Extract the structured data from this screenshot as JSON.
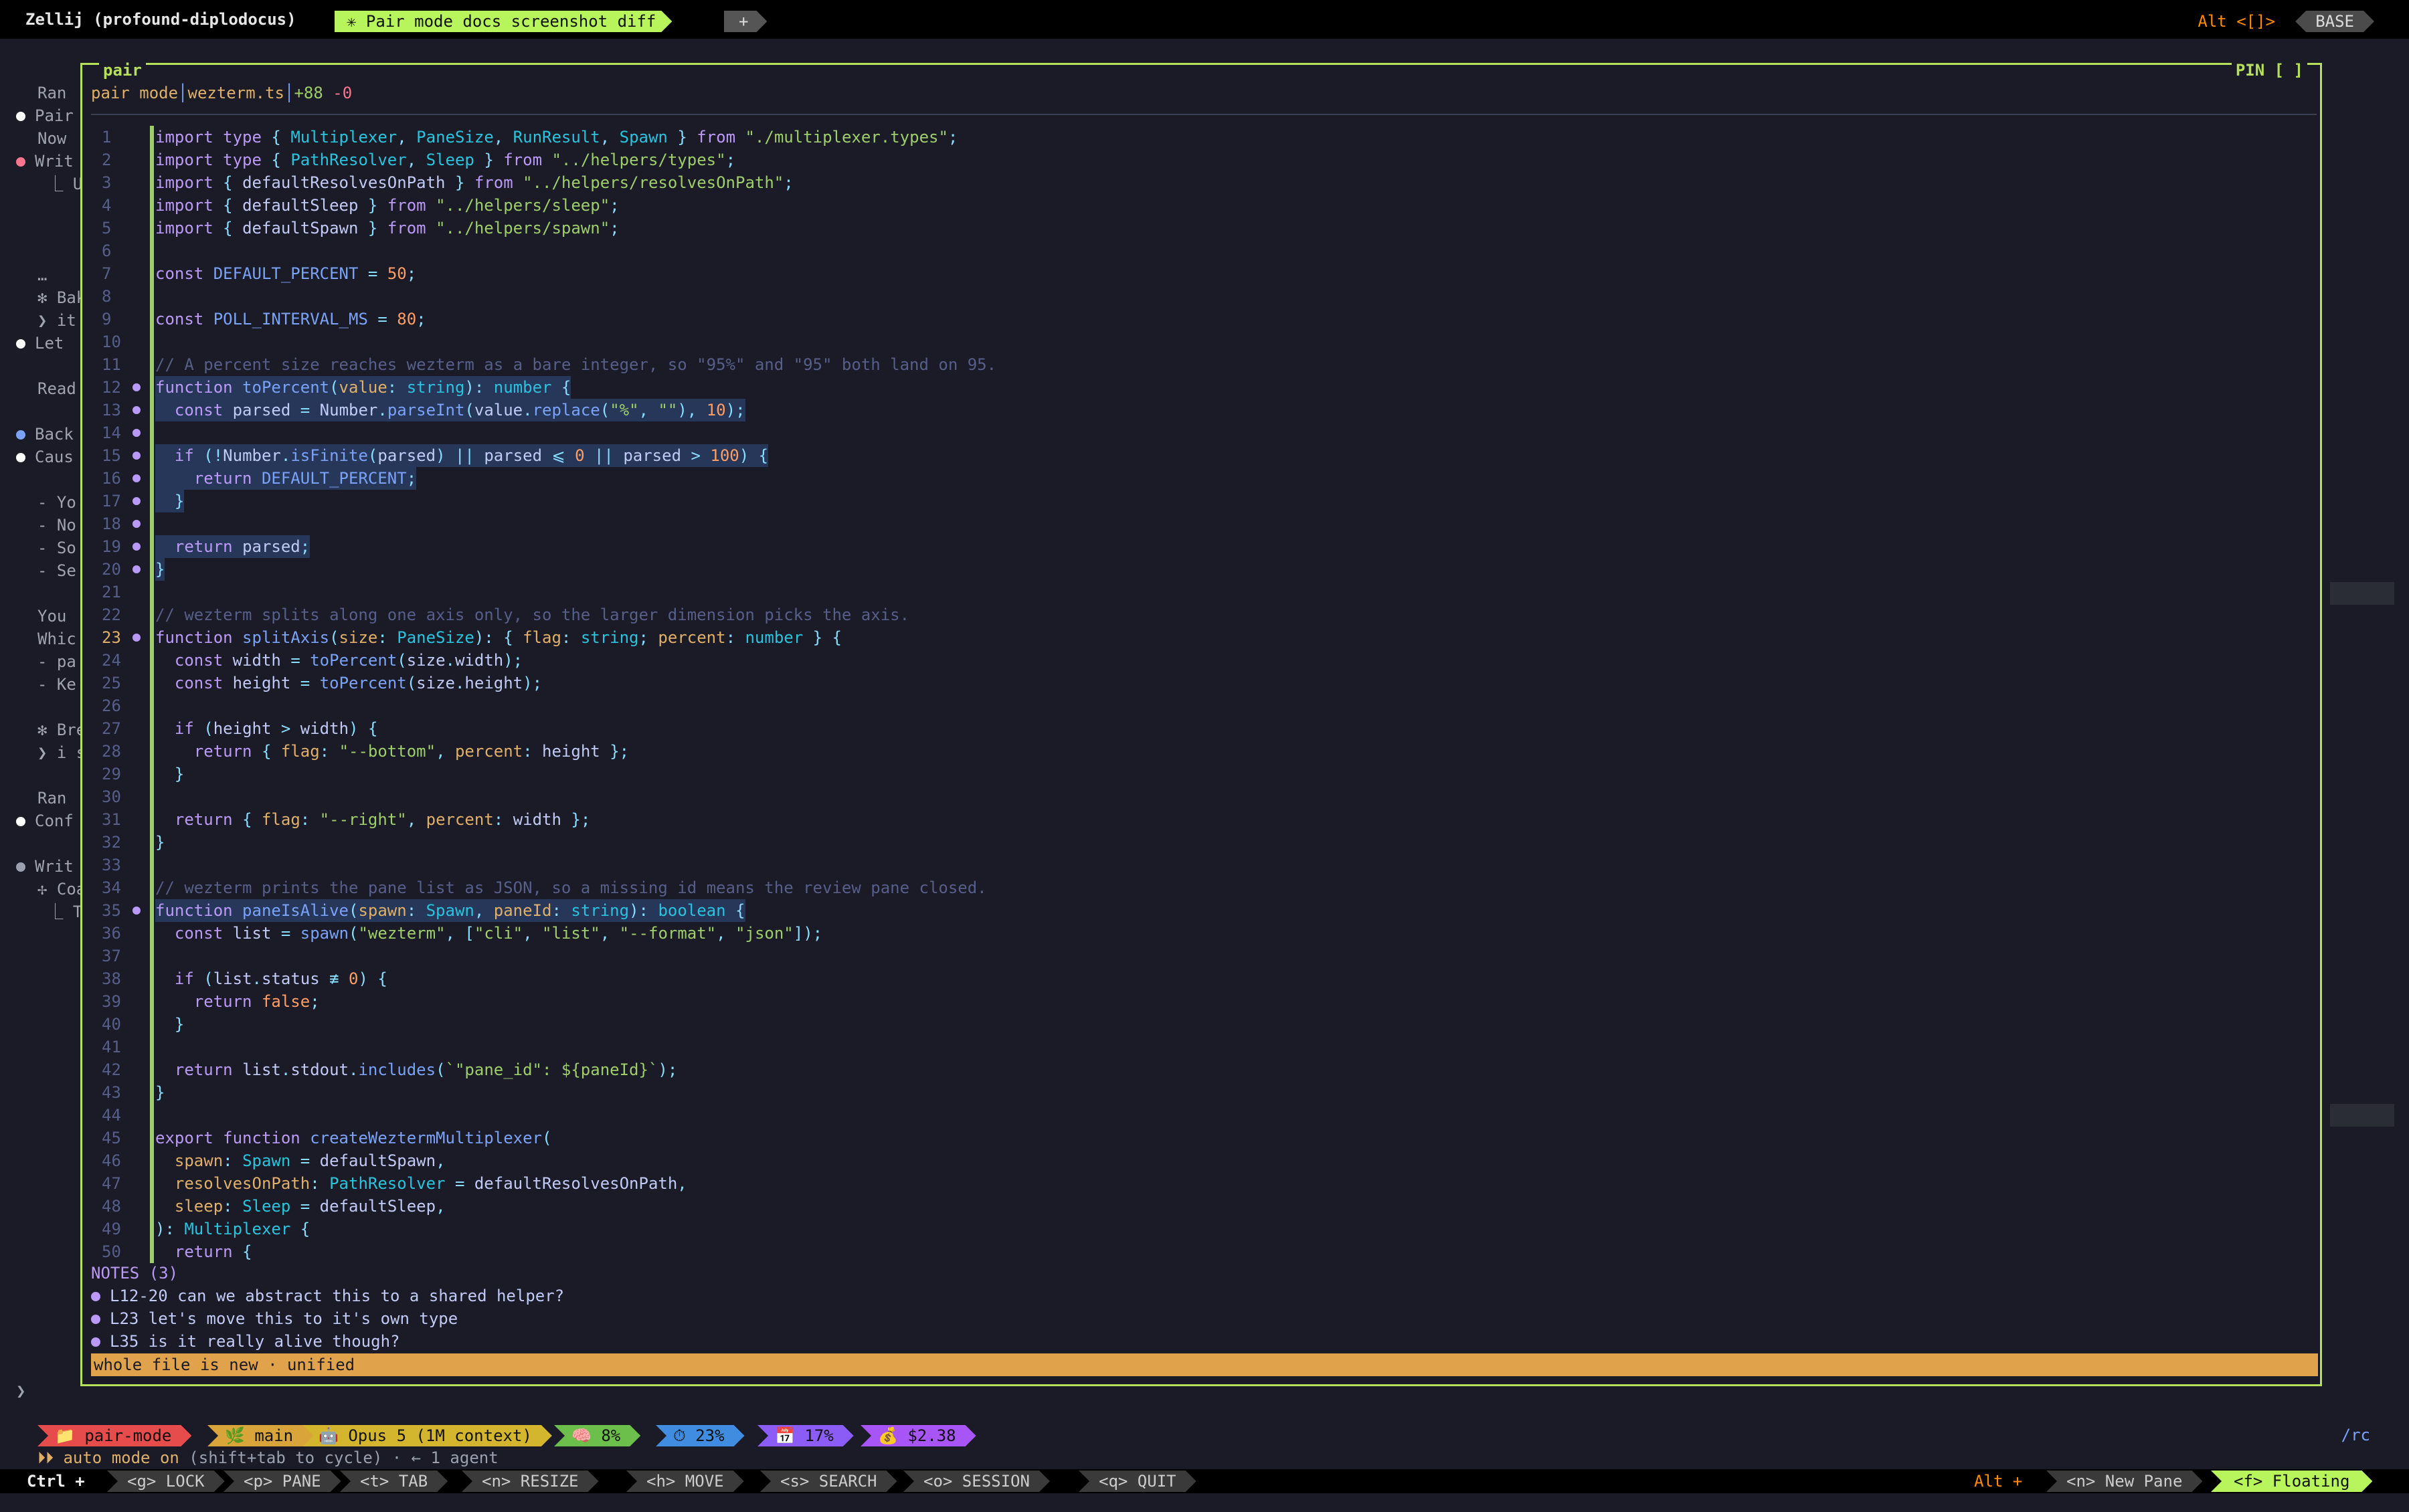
{
  "topbar": {
    "session": "Zellij (profound-diplodocus)",
    "tab": "✳ Pair mode docs screenshot diff",
    "plus": "+",
    "alt_hint": "Alt <[]>",
    "mode": "BASE"
  },
  "background_lines": [
    {
      "text": "Ran",
      "dot": null
    },
    {
      "text": "Pair",
      "dot": "#ffffff"
    },
    {
      "text": "Now",
      "dot": null
    },
    {
      "text": "Writ",
      "dot": "#f7768e"
    },
    {
      "text": " ⎿ U",
      "dot": null
    },
    {
      "text": "…",
      "dot": null
    },
    {
      "text": "✻ Bake",
      "dot": null
    },
    {
      "text": "❯ it d",
      "dot": null
    },
    {
      "text": "Let",
      "dot": "#ffffff"
    },
    {
      "text": "Read",
      "dot": null
    },
    {
      "text": "Back",
      "dot": "#7aa2f7"
    },
    {
      "text": "Caus",
      "dot": "#ffffff"
    },
    {
      "text": "- Yo",
      "dot": null
    },
    {
      "text": "- No",
      "dot": null
    },
    {
      "text": "- So",
      "dot": null
    },
    {
      "text": "- Se",
      "dot": null
    },
    {
      "text": "You",
      "dot": null
    },
    {
      "text": "Whic",
      "dot": null
    },
    {
      "text": "- pa",
      "dot": null
    },
    {
      "text": "- Ke",
      "dot": null
    },
    {
      "text": "✻ Brew",
      "dot": null
    },
    {
      "text": "❯ i sw",
      "dot": null
    },
    {
      "text": "Ran",
      "dot": null
    },
    {
      "text": "Conf",
      "dot": "#ffffff"
    },
    {
      "text": "Writ",
      "dot": "#9aa0b0"
    },
    {
      "text": "✢ Coal",
      "dot": null
    },
    {
      "text": " ⎿ T",
      "dot": null
    }
  ],
  "pane": {
    "title": "pair",
    "pin": "PIN [ ]",
    "mode_label": "pair mode",
    "file": "wezterm.ts",
    "added": "+88",
    "removed": "-0",
    "code_lines": [
      {
        "n": "1",
        "src": "import type { Multiplexer, PaneSize, RunResult, Spawn } from \"./multiplexer.types\";"
      },
      {
        "n": "2",
        "src": "import type { PathResolver, Sleep } from \"../helpers/types\";"
      },
      {
        "n": "3",
        "src": "import { defaultResolvesOnPath } from \"../helpers/resolvesOnPath\";"
      },
      {
        "n": "4",
        "src": "import { defaultSleep } from \"../helpers/sleep\";"
      },
      {
        "n": "5",
        "src": "import { defaultSpawn } from \"../helpers/spawn\";"
      },
      {
        "n": "6",
        "src": ""
      },
      {
        "n": "7",
        "src": "const DEFAULT_PERCENT = 50;"
      },
      {
        "n": "8",
        "src": ""
      },
      {
        "n": "9",
        "src": "const POLL_INTERVAL_MS = 80;"
      },
      {
        "n": "10",
        "src": ""
      },
      {
        "n": "11",
        "src": "// A percent size reaches wezterm as a bare integer, so \"95%\" and \"95\" both land on 95."
      },
      {
        "n": "12",
        "src": "function toPercent(value: string): number {",
        "note": true,
        "hl": true
      },
      {
        "n": "13",
        "src": "  const parsed = Number.parseInt(value.replace(\"%\", \"\"), 10);",
        "note": true,
        "hl": true
      },
      {
        "n": "14",
        "src": "",
        "note": true
      },
      {
        "n": "15",
        "src": "  if (!Number.isFinite(parsed) || parsed ⩽ 0 || parsed > 100) {",
        "note": true,
        "hl": true
      },
      {
        "n": "16",
        "src": "    return DEFAULT_PERCENT;",
        "note": true,
        "hl": true
      },
      {
        "n": "17",
        "src": "  }",
        "note": true,
        "hl": true
      },
      {
        "n": "18",
        "src": "",
        "note": true
      },
      {
        "n": "19",
        "src": "  return parsed;",
        "note": true,
        "hl": true
      },
      {
        "n": "20",
        "src": "}",
        "note": true,
        "hl": true
      },
      {
        "n": "21",
        "src": ""
      },
      {
        "n": "22",
        "src": "// wezterm splits along one axis only, so the larger dimension picks the axis."
      },
      {
        "n": "23",
        "src": "function splitAxis(size: PaneSize): { flag: string; percent: number } {",
        "note": true,
        "cur": true
      },
      {
        "n": "24",
        "src": "  const width = toPercent(size.width);"
      },
      {
        "n": "25",
        "src": "  const height = toPercent(size.height);"
      },
      {
        "n": "26",
        "src": ""
      },
      {
        "n": "27",
        "src": "  if (height > width) {"
      },
      {
        "n": "28",
        "src": "    return { flag: \"--bottom\", percent: height };"
      },
      {
        "n": "29",
        "src": "  }"
      },
      {
        "n": "30",
        "src": ""
      },
      {
        "n": "31",
        "src": "  return { flag: \"--right\", percent: width };"
      },
      {
        "n": "32",
        "src": "}"
      },
      {
        "n": "33",
        "src": ""
      },
      {
        "n": "34",
        "src": "// wezterm prints the pane list as JSON, so a missing id means the review pane closed."
      },
      {
        "n": "35",
        "src": "function paneIsAlive(spawn: Spawn, paneId: string): boolean {",
        "note": true,
        "hl": true
      },
      {
        "n": "36",
        "src": "  const list = spawn(\"wezterm\", [\"cli\", \"list\", \"--format\", \"json\"]);"
      },
      {
        "n": "37",
        "src": ""
      },
      {
        "n": "38",
        "src": "  if (list.status ≢ 0) {"
      },
      {
        "n": "39",
        "src": "    return false;"
      },
      {
        "n": "40",
        "src": "  }"
      },
      {
        "n": "41",
        "src": ""
      },
      {
        "n": "42",
        "src": "  return list.stdout.includes(`\"pane_id\": ${paneId}`);"
      },
      {
        "n": "43",
        "src": "}"
      },
      {
        "n": "44",
        "src": ""
      },
      {
        "n": "45",
        "src": "export function createWeztermMultiplexer("
      },
      {
        "n": "46",
        "src": "  spawn: Spawn = defaultSpawn,"
      },
      {
        "n": "47",
        "src": "  resolvesOnPath: PathResolver = defaultResolvesOnPath,"
      },
      {
        "n": "48",
        "src": "  sleep: Sleep = defaultSleep,"
      },
      {
        "n": "49",
        "src": "): Multiplexer {"
      },
      {
        "n": "50",
        "src": "  return {"
      }
    ],
    "notes_header": "NOTES (3)",
    "notes": [
      "L12-20 can we abstract this to a shared helper?",
      "L23 let's move this to it's own type",
      "L35 is it really alive though?"
    ],
    "status": "whole file is new · unified"
  },
  "prompt": "❯",
  "statusline": [
    {
      "label": "📁 pair-mode",
      "color": "#e74c4c"
    },
    {
      "label": "🌿 main",
      "color": "#d9a43a"
    },
    {
      "label": "🤖 Opus 5 (1M context)",
      "color": "#d4b62e"
    },
    {
      "label": "🧠 8%",
      "color": "#6cbf4a"
    },
    {
      "label": "⏱ 23%",
      "color": "#3f8ce0"
    },
    {
      "label": "📅 17%",
      "color": "#8b5cf6"
    },
    {
      "label": "💰 $2.38",
      "color": "#a855f7"
    }
  ],
  "rc": "/rc",
  "auto_mode": {
    "prefix": "⏵⏵ auto mode on",
    "rest": " (shift+tab to cycle) · ← 1 agent"
  },
  "keybar": {
    "ctrl": "Ctrl +",
    "keys": [
      "<g> LOCK",
      "<p> PANE",
      "<t> TAB",
      "<n> RESIZE",
      "<h> MOVE",
      "<s> SEARCH",
      "<o> SESSION",
      "<q> QUIT"
    ],
    "alt": "Alt +",
    "new_pane": "<n> New Pane",
    "floating": "<f> Floating"
  }
}
